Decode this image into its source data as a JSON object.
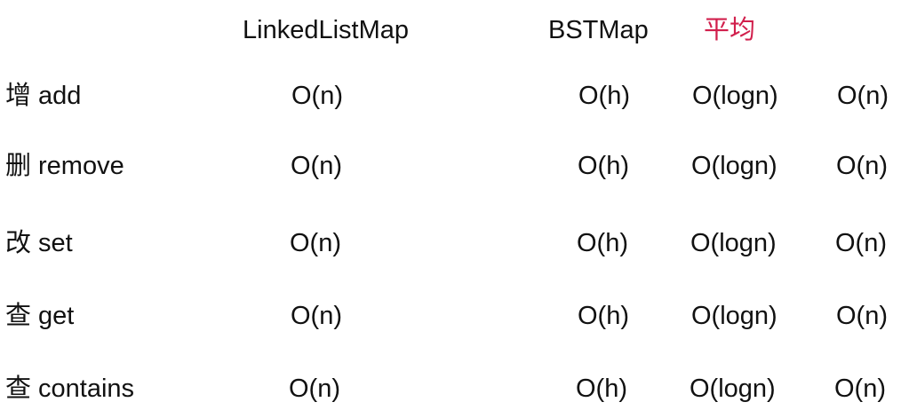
{
  "headers": {
    "linked_list_map": "LinkedListMap",
    "bst_map": "BSTMap",
    "average": "平均"
  },
  "accent_color": "#d11f4c",
  "rows": [
    {
      "zh": "增",
      "op": "add",
      "linked": "O(n)",
      "bst_h": "O(h)",
      "bst_avg": "O(logn)",
      "bst_worst": "O(n)"
    },
    {
      "zh": "删",
      "op": "remove",
      "linked": "O(n)",
      "bst_h": "O(h)",
      "bst_avg": "O(logn)",
      "bst_worst": "O(n)"
    },
    {
      "zh": "改",
      "op": "set",
      "linked": "O(n)",
      "bst_h": "O(h)",
      "bst_avg": "O(logn)",
      "bst_worst": "O(n)"
    },
    {
      "zh": "查",
      "op": "get",
      "linked": "O(n)",
      "bst_h": "O(h)",
      "bst_avg": "O(logn)",
      "bst_worst": "O(n)"
    },
    {
      "zh": "查",
      "op": "contains",
      "linked": "O(n)",
      "bst_h": "O(h)",
      "bst_avg": "O(logn)",
      "bst_worst": "O(n)"
    }
  ]
}
